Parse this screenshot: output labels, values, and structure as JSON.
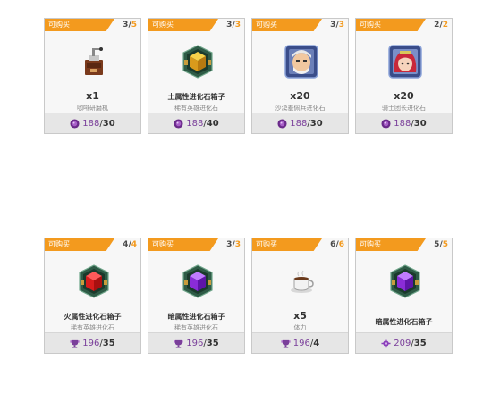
{
  "tag_label": "可购买",
  "row1": [
    {
      "count_cur": "3",
      "count_max": "5",
      "qty": "x1",
      "name": "",
      "desc": "咖啡研磨机",
      "price_have": "188",
      "price_cost": "30",
      "currency_icon": "purple-orb-icon",
      "item_icon": "coffee-grinder-icon"
    },
    {
      "count_cur": "3",
      "count_max": "3",
      "qty": "",
      "name": "土属性进化石箱子",
      "desc": "稀有英雄进化石",
      "price_have": "188",
      "price_cost": "40",
      "currency_icon": "purple-orb-icon",
      "item_icon": "earth-evolution-chest-icon"
    },
    {
      "count_cur": "3",
      "count_max": "3",
      "qty": "x20",
      "name": "",
      "desc": "沙漠羞佩兵进化石",
      "price_have": "188",
      "price_cost": "30",
      "currency_icon": "purple-orb-icon",
      "item_icon": "old-warrior-portrait-icon"
    },
    {
      "count_cur": "2",
      "count_max": "2",
      "qty": "x20",
      "name": "",
      "desc": "骑士团长进化石",
      "price_have": "188",
      "price_cost": "30",
      "currency_icon": "purple-orb-icon",
      "item_icon": "red-hair-girl-portrait-icon"
    }
  ],
  "row2": [
    {
      "count_cur": "4",
      "count_max": "4",
      "qty": "",
      "name": "火属性进化石箱子",
      "desc": "稀有英雄进化石",
      "price_have": "196",
      "price_cost": "35",
      "currency_icon": "purple-trophy-icon",
      "item_icon": "fire-evolution-chest-icon"
    },
    {
      "count_cur": "3",
      "count_max": "3",
      "qty": "",
      "name": "暗属性进化石箱子",
      "desc": "稀有英雄进化石",
      "price_have": "196",
      "price_cost": "35",
      "currency_icon": "purple-trophy-icon",
      "item_icon": "dark-evolution-chest-icon"
    },
    {
      "count_cur": "6",
      "count_max": "6",
      "qty": "x5",
      "name": "",
      "desc": "体力",
      "price_have": "196",
      "price_cost": "4",
      "currency_icon": "purple-trophy-icon",
      "item_icon": "coffee-cup-icon"
    },
    {
      "count_cur": "5",
      "count_max": "5",
      "qty": "",
      "name": "暗属性进化石箱子",
      "desc": "",
      "price_have": "209",
      "price_cost": "35",
      "currency_icon": "purple-gear-icon",
      "item_icon": "dark-evolution-chest-icon"
    }
  ]
}
